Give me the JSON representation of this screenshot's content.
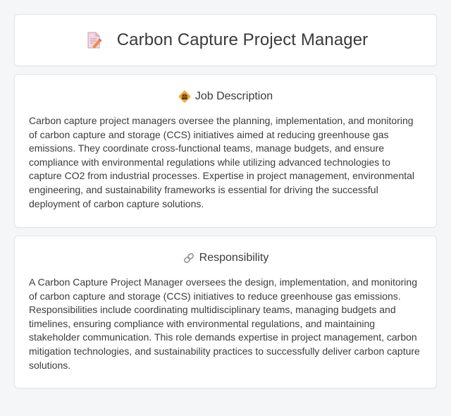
{
  "header": {
    "title": "Carbon Capture Project Manager",
    "icon": "document-pencil-icon"
  },
  "sections": [
    {
      "icon": "briefcase-badge-icon",
      "title": "Job Description",
      "body": "Carbon capture project managers oversee the planning, implementation, and monitoring of carbon capture and storage (CCS) initiatives aimed at reducing greenhouse gas emissions. They coordinate cross-functional teams, manage budgets, and ensure compliance with environmental regulations while utilizing advanced technologies to capture CO2 from industrial processes. Expertise in project management, environmental engineering, and sustainability frameworks is essential for driving the successful deployment of carbon capture solutions."
    },
    {
      "icon": "link-icon",
      "title": "Responsibility",
      "body": "A Carbon Capture Project Manager oversees the design, implementation, and monitoring of carbon capture and storage (CCS) initiatives to reduce greenhouse gas emissions. Responsibilities include coordinating multidisciplinary teams, managing budgets and timelines, ensuring compliance with environmental regulations, and maintaining stakeholder communication. This role demands expertise in project management, carbon mitigation technologies, and sustainability practices to successfully deliver carbon capture solutions."
    }
  ],
  "colors": {
    "background": "#f5f6f8",
    "card": "#ffffff",
    "border": "#e3e5e8",
    "text": "#3c3c3c",
    "accent_orange": "#f2a93b"
  }
}
